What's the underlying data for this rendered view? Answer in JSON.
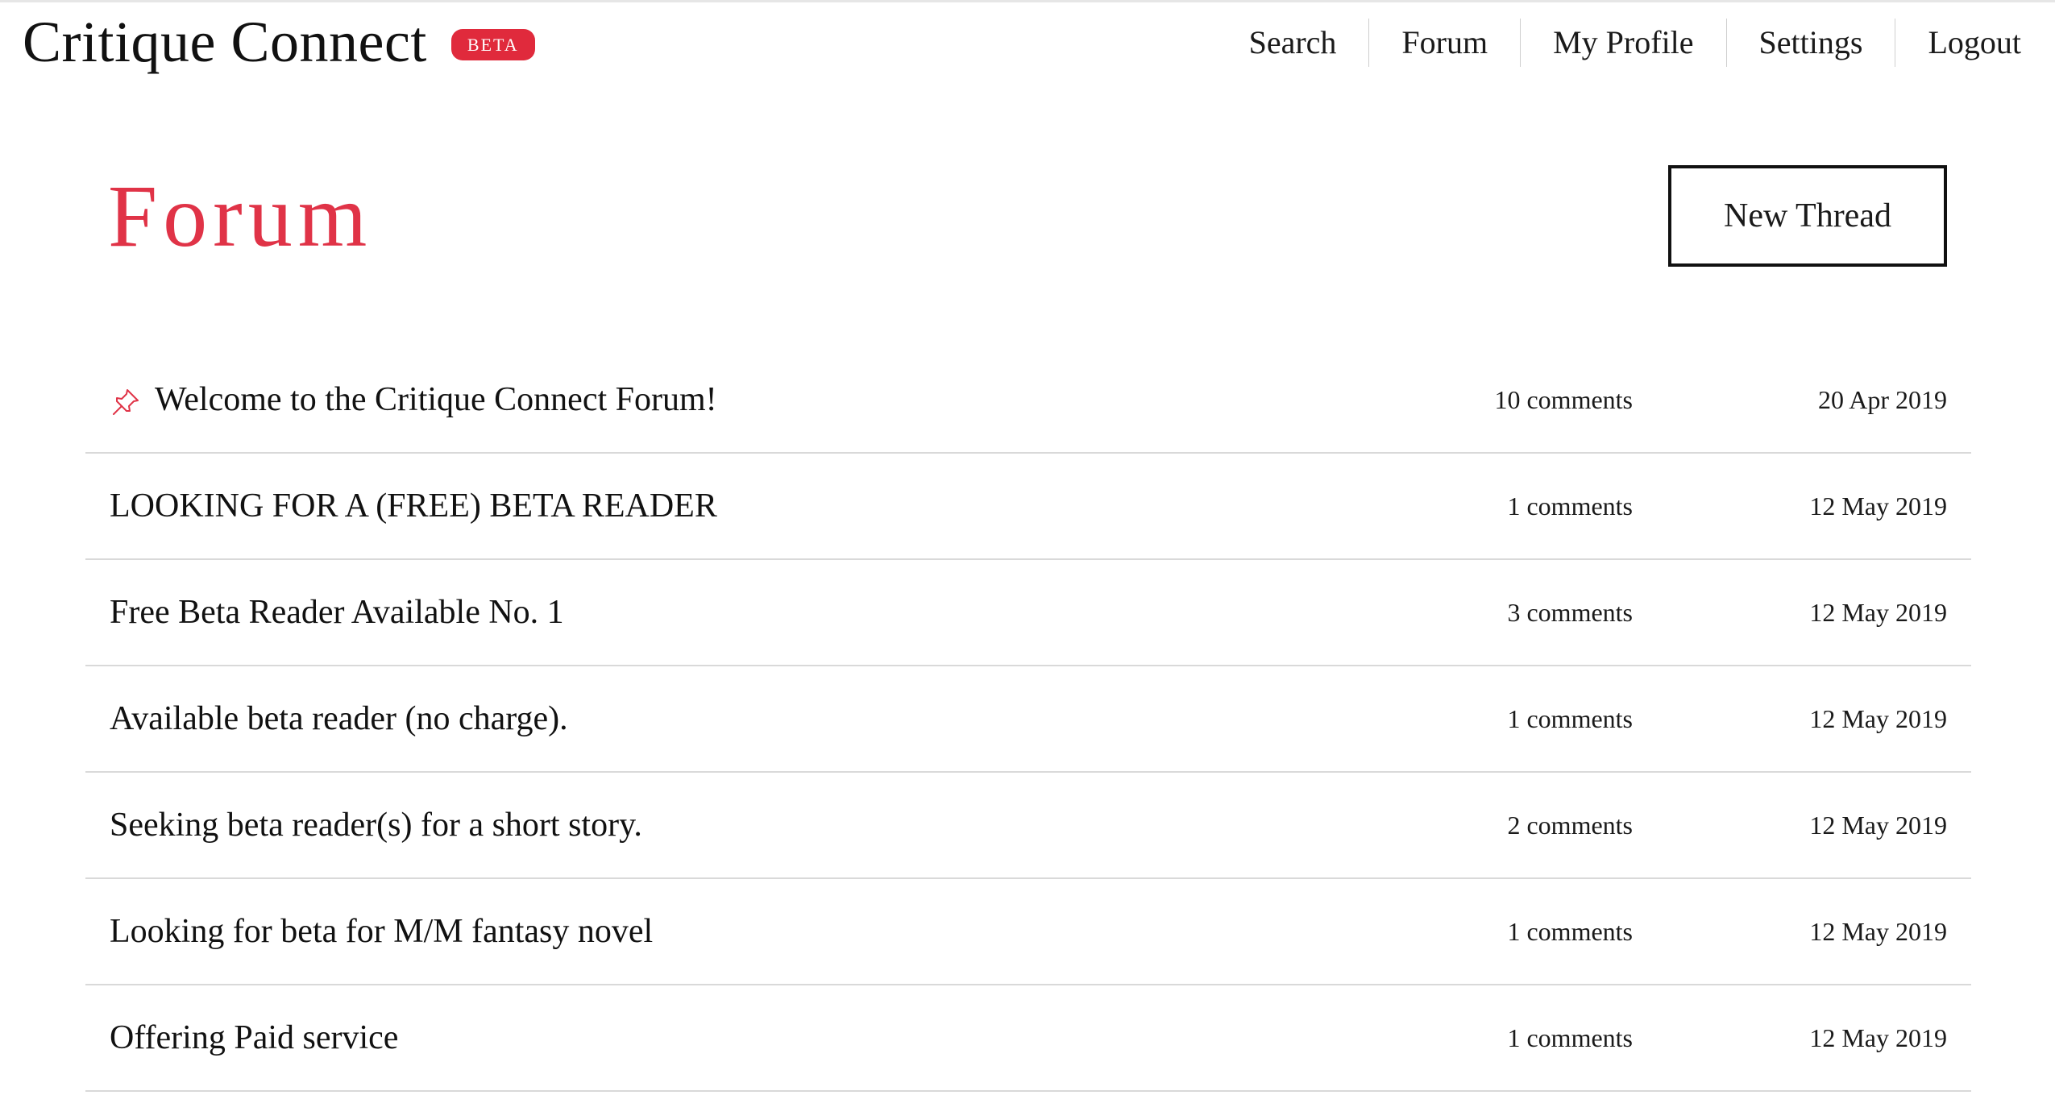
{
  "app": {
    "name": "Critique Connect",
    "badge": "BETA"
  },
  "nav": {
    "items": [
      {
        "label": "Search"
      },
      {
        "label": "Forum"
      },
      {
        "label": "My Profile"
      },
      {
        "label": "Settings"
      },
      {
        "label": "Logout"
      }
    ]
  },
  "page": {
    "title": "Forum",
    "new_thread_label": "New Thread"
  },
  "threads": [
    {
      "title": "Welcome to the Critique Connect Forum!",
      "comments": "10 comments",
      "date": "20 Apr 2019",
      "pinned": true,
      "icon": "pin-icon"
    },
    {
      "title": "LOOKING FOR A (FREE) BETA READER",
      "comments": "1 comments",
      "date": "12 May 2019",
      "pinned": false
    },
    {
      "title": "Free Beta Reader Available No. 1",
      "comments": "3 comments",
      "date": "12 May 2019",
      "pinned": false
    },
    {
      "title": "Available beta reader (no charge).",
      "comments": "1 comments",
      "date": "12 May 2019",
      "pinned": false
    },
    {
      "title": "Seeking beta reader(s) for a short story.",
      "comments": "2 comments",
      "date": "12 May 2019",
      "pinned": false
    },
    {
      "title": "Looking for beta for M/M fantasy novel",
      "comments": "1 comments",
      "date": "12 May 2019",
      "pinned": false
    },
    {
      "title": "Offering Paid service",
      "comments": "1 comments",
      "date": "12 May 2019",
      "pinned": false
    }
  ],
  "colors": {
    "accent": "#e03347",
    "badge_bg": "#e02a3c",
    "divider": "#d9d9d9"
  }
}
